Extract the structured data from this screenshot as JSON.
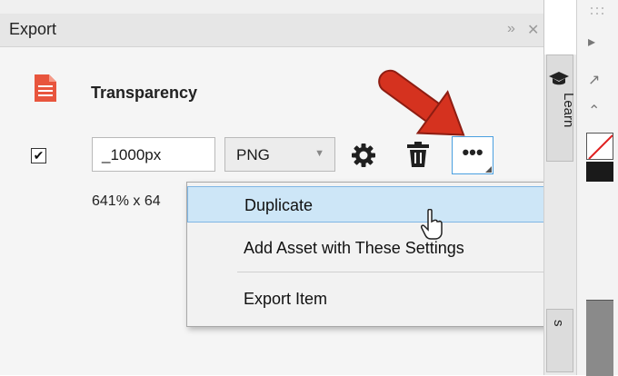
{
  "panel": {
    "title": "Export",
    "pin_icon": "double-chevron-right-icon",
    "close_icon": "close-icon"
  },
  "asset": {
    "name": "Transparency",
    "icon": "file-document-icon",
    "icon_color": "#e8553d"
  },
  "export_row": {
    "enabled": true,
    "checkbox_mark": "✔",
    "suffix_value": "_1000px",
    "format_value": "PNG",
    "settings_icon": "gear-icon",
    "delete_icon": "trash-icon",
    "more_label": "•••",
    "dimensions_text": "641% x 64"
  },
  "context_menu": {
    "items": [
      {
        "label": "Duplicate",
        "highlighted": true
      },
      {
        "label": "Add Asset with These Settings",
        "highlighted": false
      },
      {
        "label": "Export Item",
        "highlighted": false
      }
    ]
  },
  "docker_tabs": {
    "learn_label": "Learn",
    "learn_icon": "graduation-cap-icon",
    "bottom_tab_label": "s"
  },
  "toolbar": {
    "play_icon": "triangle-right-icon",
    "eyedropper_icon": "eyedropper-icon",
    "collapse_icon": "chevron-up-icon"
  },
  "accent_colors": {
    "arrow": "#d5321f",
    "menu_highlight": "#cde6f7",
    "focus_border": "#4a9fe0"
  }
}
